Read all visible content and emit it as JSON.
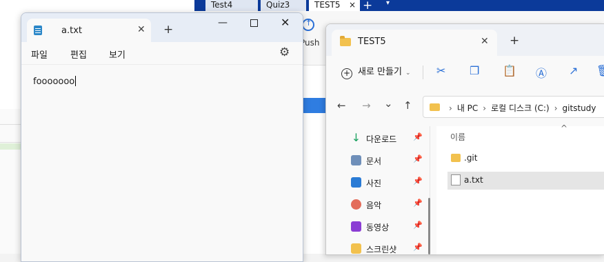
{
  "background_app": {
    "tabs": [
      "Test4",
      "Quiz3",
      "TEST5"
    ],
    "tab_close": "×",
    "new_tab": "+",
    "tab_menu": "▾",
    "push_label": "Push"
  },
  "notepad": {
    "tab_title": "a.txt",
    "tab_close": "✕",
    "new_tab": "+",
    "minimize": "—",
    "close": "✕",
    "menu": [
      "파일",
      "편집",
      "보기"
    ],
    "settings_icon": "⚙",
    "content": "fooooooo"
  },
  "explorer": {
    "tab_title": "TEST5",
    "tab_close": "✕",
    "new_tab": "+",
    "new_button": "새로 만들기",
    "new_plus": "+",
    "new_dropdown": "⌄",
    "cmd_icons": {
      "cut": "✂",
      "copy": "❐",
      "paste": "📋",
      "rename": "Ⓐ",
      "share": "↗",
      "delete": "🗑"
    },
    "nav": {
      "back": "←",
      "forward": "→",
      "recent": "⌄",
      "up": "↑"
    },
    "address": [
      "내 PC",
      "로컬 디스크 (C:)",
      "gitstudy"
    ],
    "address_sep": "›",
    "quick_access": [
      {
        "label": "다운로드",
        "icon": "↓"
      },
      {
        "label": "문서"
      },
      {
        "label": "사진"
      },
      {
        "label": "음악"
      },
      {
        "label": "동영상"
      },
      {
        "label": "스크린샷"
      }
    ],
    "pin_icon": "📌",
    "sort_icon": "^",
    "column_name": "이름",
    "files": [
      {
        "name": ".git",
        "type": "folder"
      },
      {
        "name": "a.txt",
        "type": "text",
        "selected": true
      }
    ]
  }
}
